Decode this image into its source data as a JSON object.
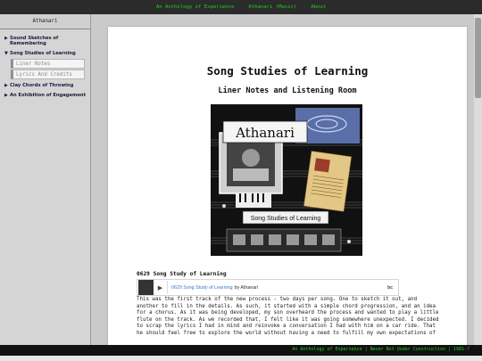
{
  "nav": {
    "items": [
      "An Anthology of Experience",
      "Athanari (Music)",
      "About"
    ]
  },
  "sidebar": {
    "title": "Athanari",
    "items": [
      {
        "arrow": "▶",
        "label": "Sound Sketches of Remembering"
      },
      {
        "arrow": "▼",
        "label": "Song Studies of Learning"
      },
      {
        "arrow": "▶",
        "label": "Clay Chords of Throwing"
      },
      {
        "arrow": "▶",
        "label": "An Exhibition of Engagement"
      }
    ],
    "subitems": [
      "Liner Notes",
      "Lyrics And Credits"
    ]
  },
  "main": {
    "title": "Song Studies of Learning",
    "subtitle": "Liner Notes and Listening Room",
    "cover": {
      "logo_text": "Athanari",
      "banner_text": "Song Studies of Learning"
    },
    "track": {
      "heading": "0629 Song Study of Learning",
      "player_title": "0629 Song Study of Learning",
      "player_by": "by Athanari",
      "player_badge": "bc",
      "text": "This was the first track of the new process - two days per song. One to sketch it out, and another to fill in the details. As such, it started with a simple chord progression, and an idea for a chorus. As it was being developed, my son overheard the process and wanted to play a little flute on the track. As we recorded that, I felt like it was going somewhere unexpected. I decided to scrap the lyrics I had in mind and reinvoke a conversation I had with him on a car ride. That he should feel free to explore the world without having a need to fulfill my own expectations of"
    }
  },
  "footer": {
    "text": "An Anthology of Experience | Never Not Under Construction | 1981-?"
  },
  "colors": {
    "nav_bg": "#2b2b2b",
    "nav_link": "#1fd11f",
    "sidebar_bg": "#d5d5d5",
    "link_blue": "#3a78c9"
  }
}
